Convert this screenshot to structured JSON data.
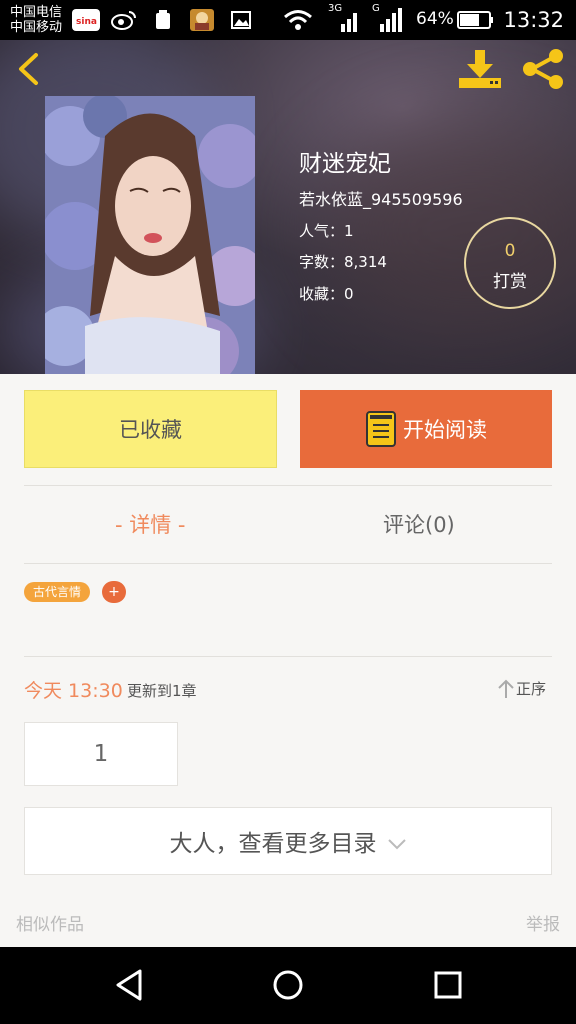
{
  "status_bar": {
    "carrier_line1": "中国电信",
    "carrier_line2": "中国移动",
    "signal_3g": "3G",
    "signal_g": "G",
    "battery": "64%",
    "time": "13:32",
    "icons": [
      "sina-icon",
      "weibo-icon",
      "recycle-icon",
      "game-icon",
      "image-icon",
      "wifi-icon",
      "signal-icon",
      "battery-icon"
    ]
  },
  "book": {
    "title": "财迷宠妃",
    "author": "若水依蓝_945509596",
    "popularity": "人气：1",
    "word_count": "字数：8,314",
    "favorites": "收藏：0"
  },
  "reward": {
    "count": "0",
    "label": "打赏"
  },
  "actions": {
    "favorite": "已收藏",
    "read": "开始阅读"
  },
  "tabs": {
    "detail": "- 详情 -",
    "comments": "评论(0)"
  },
  "tags": {
    "genre": "古代言情",
    "add": "+"
  },
  "update": {
    "time": "今天 13:30",
    "info": "更新到1章",
    "sort": "正序"
  },
  "chapter": {
    "number": "1"
  },
  "more_catalog": "大人，查看更多目录",
  "footer": {
    "similar": "相似作品",
    "report": "举报"
  },
  "colors": {
    "accent": "#e86b3b",
    "favorite_bg": "#fbef7a",
    "tab_active": "#f08a5d",
    "tag": "#f4a43c"
  }
}
